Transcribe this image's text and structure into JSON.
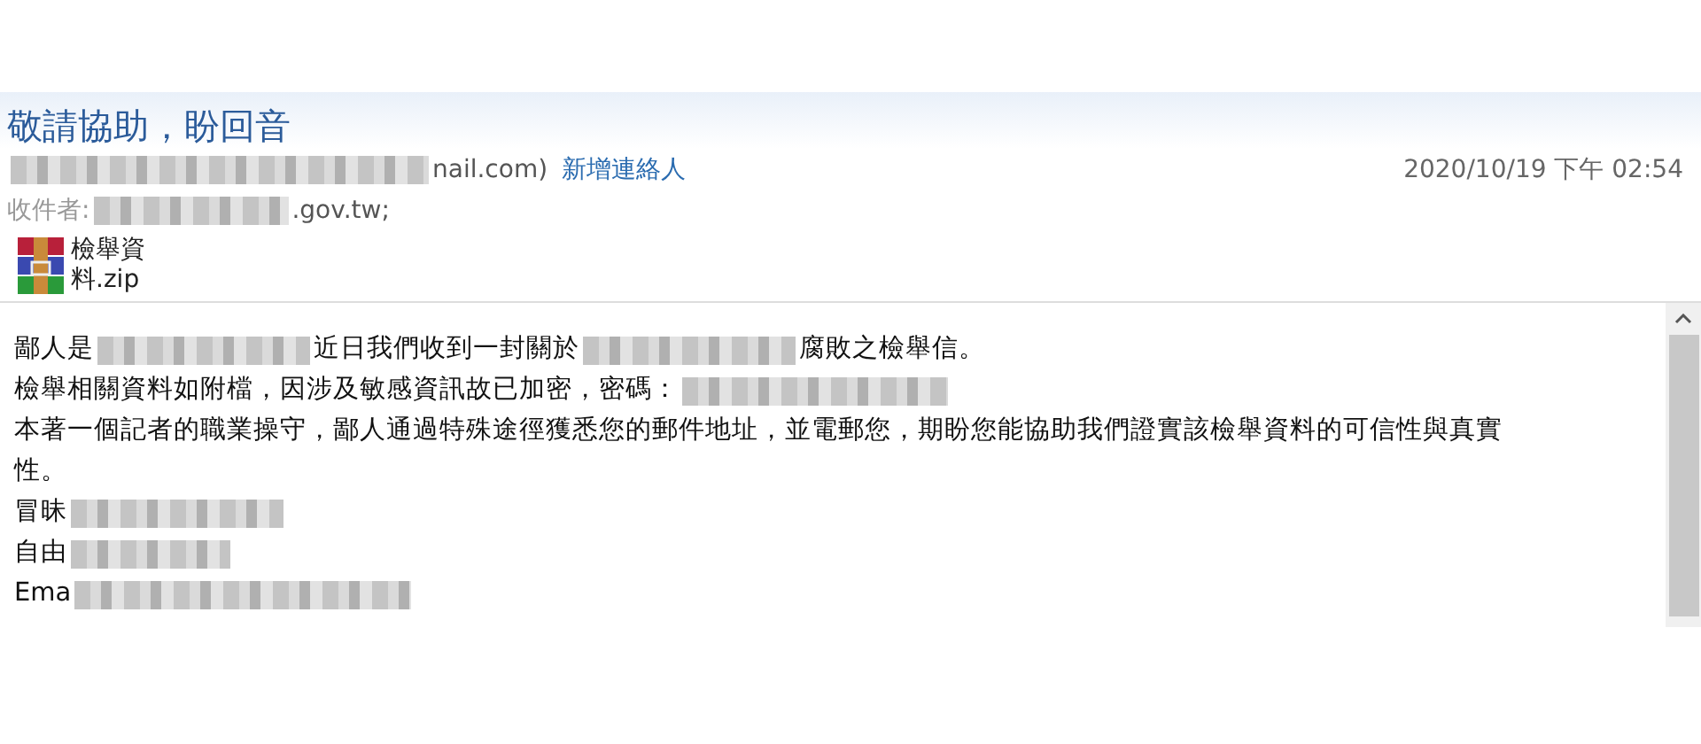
{
  "subject": "敬請協助，盼回音",
  "sender": {
    "parts": [
      {
        "kind": "redacted"
      },
      {
        "kind": "text",
        "text": "nail.com)"
      }
    ],
    "add_contact": "新增連絡人"
  },
  "date": "2020/10/19 下午 02:54",
  "recipients": {
    "label": "收件者:",
    "parts": [
      {
        "kind": "redacted"
      },
      {
        "kind": "text",
        "text": ".gov.tw;"
      }
    ]
  },
  "attachment": {
    "name_lines": [
      "檢舉資",
      "料.zip"
    ]
  },
  "body": [
    {
      "parts": [
        {
          "kind": "text",
          "text": "鄙人是"
        },
        {
          "kind": "redacted"
        },
        {
          "kind": "text",
          "text": "近日我們收到一封關於"
        },
        {
          "kind": "redacted"
        },
        {
          "kind": "text",
          "text": "腐敗之檢舉信。"
        }
      ]
    },
    {
      "parts": [
        {
          "kind": "text",
          "text": "檢舉相關資料如附檔，因涉及敏感資訊故已加密，密碼："
        },
        {
          "kind": "redacted"
        }
      ]
    },
    {
      "parts": [
        {
          "kind": "text",
          "text": "本著一個記者的職業操守，鄙人通過特殊途徑獲悉您的郵件地址，並電郵您，期盼您能協助我們證實該檢舉資料的可信性與真實"
        }
      ]
    },
    {
      "parts": [
        {
          "kind": "text",
          "text": "性。"
        }
      ]
    },
    {
      "parts": [
        {
          "kind": "text",
          "text": "冒昧"
        },
        {
          "kind": "redacted"
        }
      ]
    },
    {
      "parts": [
        {
          "kind": "text",
          "text": "自由"
        },
        {
          "kind": "redacted"
        }
      ]
    },
    {
      "parts": [
        {
          "kind": "text",
          "text": "Ema"
        },
        {
          "kind": "redacted"
        }
      ]
    }
  ]
}
